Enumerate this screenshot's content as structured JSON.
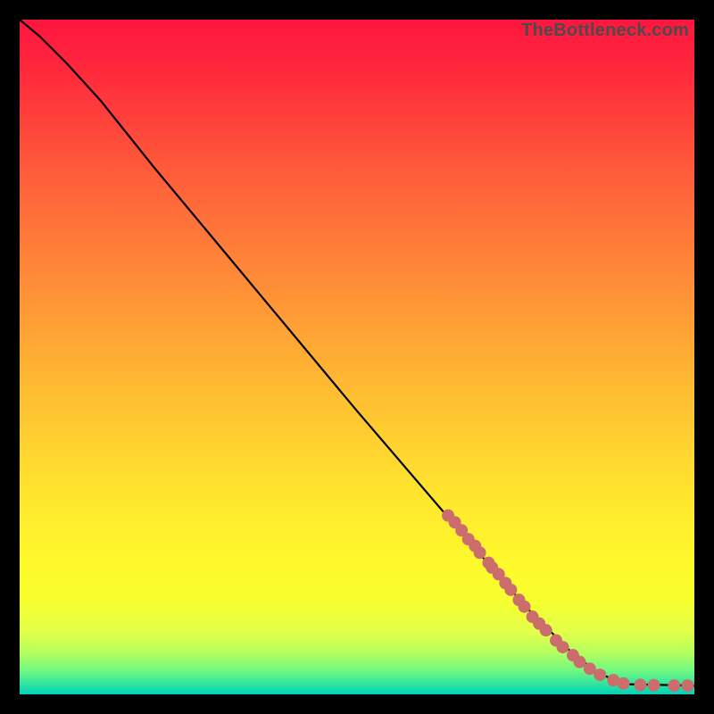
{
  "watermark": "TheBottleneck.com",
  "chart_data": {
    "type": "line",
    "title": "",
    "xlabel": "",
    "ylabel": "",
    "xlim": [
      0,
      100
    ],
    "ylim": [
      0,
      100
    ],
    "curve": [
      {
        "x": 0,
        "y": 100
      },
      {
        "x": 3,
        "y": 97.5
      },
      {
        "x": 7,
        "y": 93.5
      },
      {
        "x": 12,
        "y": 88
      },
      {
        "x": 20,
        "y": 78
      },
      {
        "x": 35,
        "y": 60
      },
      {
        "x": 50,
        "y": 42
      },
      {
        "x": 65,
        "y": 24.5
      },
      {
        "x": 75,
        "y": 13
      },
      {
        "x": 82,
        "y": 6
      },
      {
        "x": 86,
        "y": 3
      },
      {
        "x": 90,
        "y": 1.5
      },
      {
        "x": 100,
        "y": 1.3
      }
    ],
    "series": [
      {
        "name": "points",
        "values": [
          {
            "x": 63.5,
            "y": 26.5
          },
          {
            "x": 64.5,
            "y": 25.5
          },
          {
            "x": 65.5,
            "y": 24.3
          },
          {
            "x": 66.5,
            "y": 23.0
          },
          {
            "x": 67.5,
            "y": 22.0
          },
          {
            "x": 68.2,
            "y": 21.0
          },
          {
            "x": 69.5,
            "y": 19.5
          },
          {
            "x": 70.0,
            "y": 18.8
          },
          {
            "x": 71.0,
            "y": 17.8
          },
          {
            "x": 72.0,
            "y": 16.5
          },
          {
            "x": 72.8,
            "y": 15.5
          },
          {
            "x": 74.0,
            "y": 14.0
          },
          {
            "x": 74.8,
            "y": 13.0
          },
          {
            "x": 76.0,
            "y": 11.5
          },
          {
            "x": 77.0,
            "y": 10.5
          },
          {
            "x": 78.0,
            "y": 9.5
          },
          {
            "x": 79.5,
            "y": 8.0
          },
          {
            "x": 80.5,
            "y": 7.0
          },
          {
            "x": 82.0,
            "y": 5.8
          },
          {
            "x": 83.0,
            "y": 4.8
          },
          {
            "x": 84.5,
            "y": 3.8
          },
          {
            "x": 86.0,
            "y": 2.9
          },
          {
            "x": 88.0,
            "y": 2.1
          },
          {
            "x": 89.5,
            "y": 1.6
          },
          {
            "x": 92.0,
            "y": 1.4
          },
          {
            "x": 94.0,
            "y": 1.35
          },
          {
            "x": 97.0,
            "y": 1.3
          },
          {
            "x": 99.0,
            "y": 1.3
          }
        ]
      }
    ]
  }
}
